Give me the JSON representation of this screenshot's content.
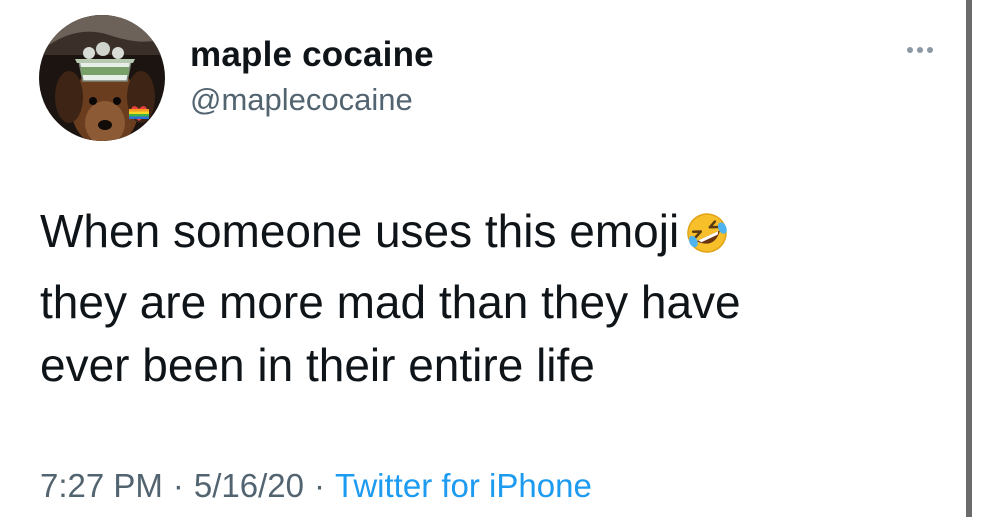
{
  "author": {
    "display_name": "maple cocaine",
    "handle": "@maplecocaine",
    "avatar_icon": "dog-avatar-photo"
  },
  "more_icon": "ellipsis-icon",
  "tweet": {
    "lines": [
      "When someone uses this emoji",
      "they are more mad than they have",
      "ever been in their entire life"
    ],
    "emoji_icon": "rolling-on-floor-laughing-emoji"
  },
  "meta": {
    "time": "7:27 PM",
    "separator": "·",
    "date": "5/16/20",
    "source": "Twitter for iPhone"
  },
  "colors": {
    "text": "#0f1419",
    "secondary": "#536471",
    "link": "#1d9bf0"
  }
}
